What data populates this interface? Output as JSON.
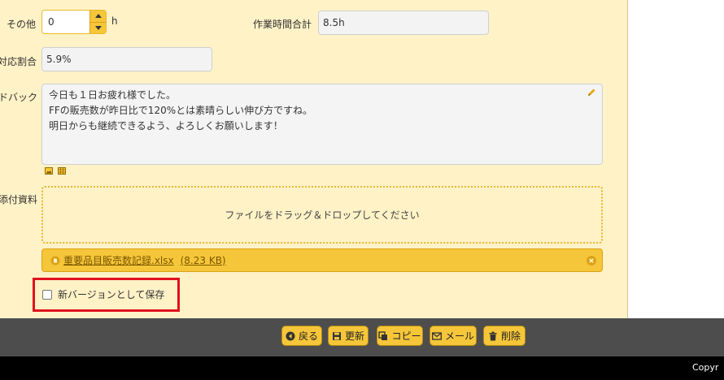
{
  "fields": {
    "other_label": "その他",
    "other_value": "0",
    "unit_hours": "h",
    "total_hours_label": "作業時間合計",
    "total_hours_value": "8.5h",
    "ratio_label": "対応割合",
    "ratio_value": "5.9%",
    "feedback_label": "ドバック",
    "feedback_lines": [
      "今日も１日お疲れ様でした。",
      "FFの販売数が昨日比で120%とは素晴らしい伸び方ですね。",
      "明日からも継続できるよう、よろしくお願いします！"
    ],
    "attachments_label": "添付資料"
  },
  "dropzone": {
    "text": "ファイルをドラッグ＆ドロップしてください"
  },
  "attachment": {
    "filename": "重要品目販売数記録.xlsx",
    "size": "(8.23 KB)"
  },
  "checkbox": {
    "label": "新バージョンとして保存",
    "checked": false
  },
  "toolbar": {
    "back": "戻る",
    "update": "更新",
    "copy": "コピー",
    "mail": "メール",
    "delete": "削除"
  },
  "footer": {
    "copyright": "Copyr"
  },
  "colors": {
    "panel": "#fff2c7",
    "accent": "#f6c63a",
    "highlight": "#e0121c",
    "toolbar": "#4d4d4d",
    "footer": "#000000"
  },
  "icons": [
    "chevron-up-icon",
    "chevron-down-icon",
    "pencil-icon",
    "image-icon",
    "table-icon",
    "file-icon",
    "close-circle-icon",
    "back-icon",
    "save-icon",
    "copy-icon",
    "mail-icon",
    "trash-icon"
  ]
}
